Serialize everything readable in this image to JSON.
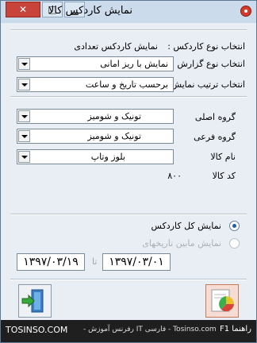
{
  "window": {
    "title": "نمایش کاردکس کالا",
    "min_glyph": "▁",
    "restore_glyph": "□",
    "close_glyph": "✕"
  },
  "fields": {
    "selection_type": {
      "label": "انتخاب نوع کاردکس :",
      "value": "نمایش کاردکس تعدادی"
    },
    "report_type": {
      "label": "انتخاب نوع گزارش",
      "value": "نمایش با ریز امانی"
    },
    "sort_order": {
      "label": "انتخاب ترتیب نمایش",
      "value": "برحسب تاریخ و ساعت"
    },
    "main_group": {
      "label": "گروه اصلی",
      "value": "تونیک و شومیز"
    },
    "sub_group": {
      "label": "گروه فرعی",
      "value": "تونیک و شومیز"
    },
    "product_name": {
      "label": "نام کالا",
      "value": "بلوز وتاپ"
    },
    "product_code": {
      "label": "کد کالا",
      "value": "۸۰۰"
    }
  },
  "options": {
    "show_all": {
      "label": "نمایش کل کاردکس",
      "selected": true,
      "enabled": true
    },
    "show_between": {
      "label": "نمایش مابین تاریخهای",
      "selected": false,
      "enabled": false
    }
  },
  "dates": {
    "to": "۱۳۹۷/۰۳/۱۹",
    "separator": "تا",
    "from": "۱۳۹۷/۰۳/۰۱"
  },
  "status_bar": {
    "left_text": "TOSINSO.COM",
    "center_text": "- رفرنس آموزش IT فارسی - Tosinso.com",
    "right_text": "راهنما F1"
  },
  "colors": {
    "title_bg": "#cbdbeb",
    "body_bg": "#e9eef4",
    "close_btn": "#c8443a"
  }
}
